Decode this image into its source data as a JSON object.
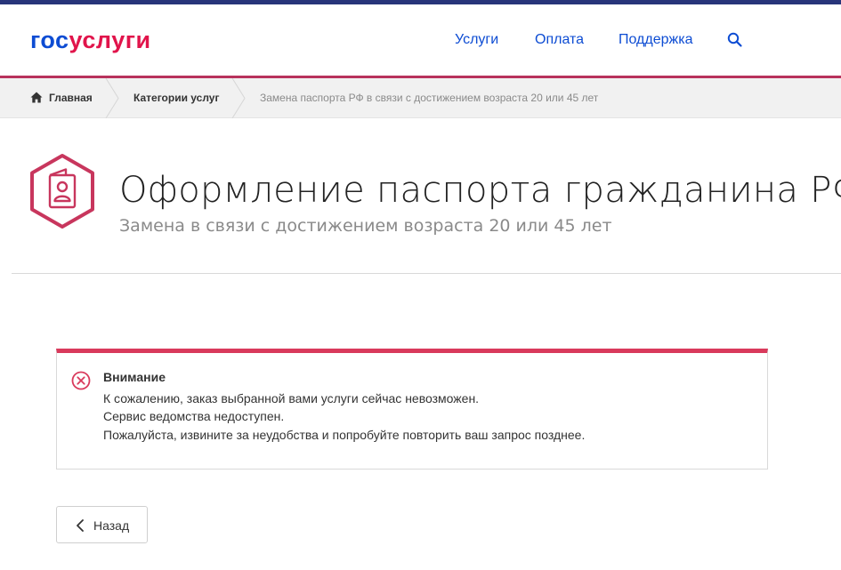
{
  "header": {
    "logo_part1": "гос",
    "logo_part2": "услуги",
    "nav": {
      "services": "Услуги",
      "payment": "Оплата",
      "support": "Поддержка"
    }
  },
  "breadcrumb": {
    "home": "Главная",
    "categories": "Категории услуг",
    "current": "Замена паспорта РФ в связи с достижением возраста 20 или 45 лет"
  },
  "service": {
    "title": "Оформление паспорта гражданина РФ",
    "subtitle": "Замена в связи с достижением возраста 20 или 45 лет"
  },
  "alert": {
    "title": "Внимание",
    "lines": [
      "К сожалению, заказ выбранной вами услуги сейчас невозможен.",
      "Сервис ведомства недоступен.",
      "Пожалуйста, извините за неудобства и попробуйте повторить ваш запрос позднее."
    ]
  },
  "back_button": {
    "label": "Назад"
  },
  "colors": {
    "brand_blue": "#0d4cd3",
    "brand_red": "#e1144b",
    "accent_crimson": "#c8365d",
    "alert_red": "#d93a5c",
    "top_stripe": "#28357a"
  },
  "icons": {
    "search": "search-icon",
    "home": "home-icon",
    "passport": "passport-icon",
    "error": "error-circle-icon",
    "back": "chevron-left-icon"
  }
}
